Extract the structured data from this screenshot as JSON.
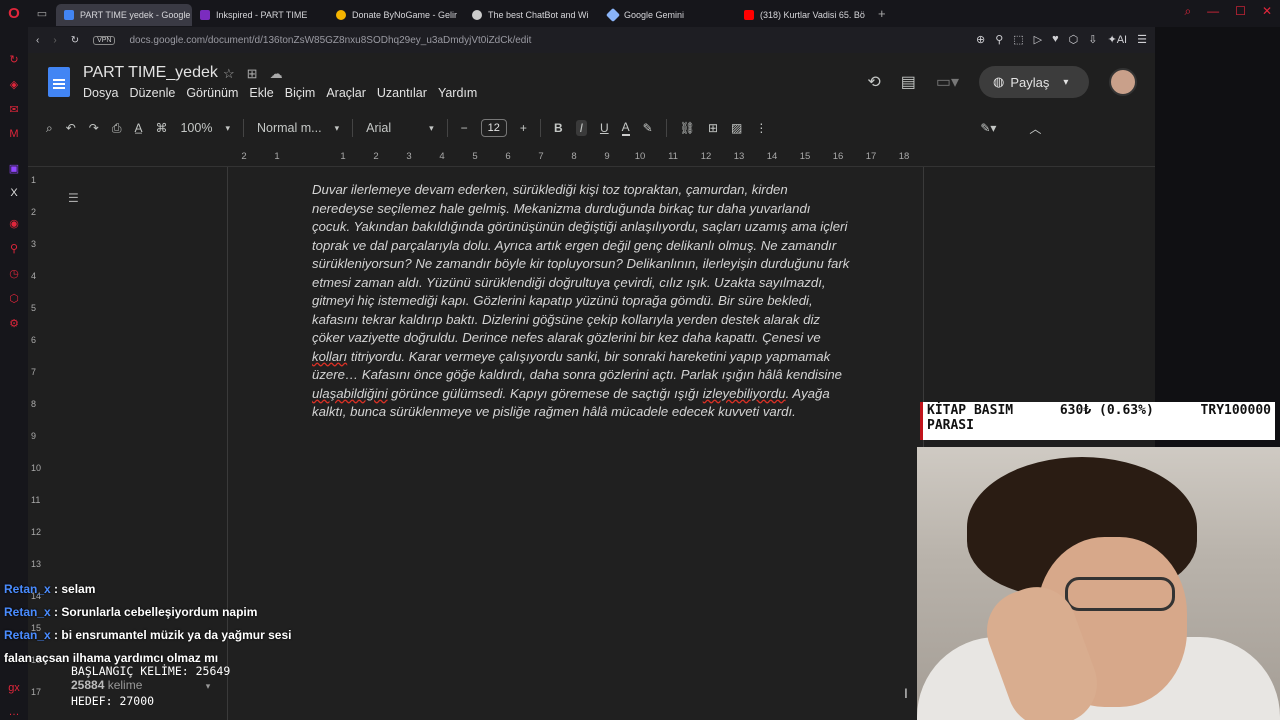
{
  "browser": {
    "tabs": [
      {
        "label": "PART TIME yedek - Google",
        "active": true,
        "color": "#4285f4"
      },
      {
        "label": "Inkspired - PART TIME",
        "active": false,
        "color": "#7b2cbf"
      },
      {
        "label": "Donate ByNoGame - Gelir",
        "active": false,
        "color": "#f4b400"
      },
      {
        "label": "The best ChatBot and Wi",
        "active": false,
        "color": "#cccccc"
      },
      {
        "label": "Google Gemini",
        "active": false,
        "color": "#8ab4f8"
      },
      {
        "label": "(318) Kurtlar Vadisi 65. Bö",
        "active": false,
        "color": "#ff0000"
      }
    ],
    "vpn": "VPN",
    "url": "docs.google.com/document/d/136tonZsW85GZ8nxu8SODhq29ey_u3aDmdyjVt0iZdCk/edit",
    "ai_label": "AI"
  },
  "docs": {
    "title": "PART TIME_yedek",
    "menu": [
      "Dosya",
      "Düzenle",
      "Görünüm",
      "Ekle",
      "Biçim",
      "Araçlar",
      "Uzantılar",
      "Yardım"
    ],
    "share_label": "Paylaş",
    "toolbar": {
      "zoom": "100%",
      "style": "Normal m...",
      "font": "Arial",
      "size": "12"
    },
    "ruler_h": [
      "2",
      "1",
      "",
      "1",
      "2",
      "3",
      "4",
      "5",
      "6",
      "7",
      "8",
      "9",
      "10",
      "11",
      "12",
      "13",
      "14",
      "15",
      "16",
      "17",
      "18"
    ],
    "ruler_v": [
      "1",
      "2",
      "3",
      "4",
      "5",
      "6",
      "7",
      "8",
      "9",
      "10",
      "11",
      "12",
      "13",
      "14",
      "15",
      "16",
      "17"
    ],
    "paragraph_parts": [
      "Duvar ilerlemeye devam ederken, sürüklediği kişi toz topraktan, çamurdan, kirden neredeyse seçilemez hale gelmiş. Mekanizma durduğunda birkaç tur daha yuvarlandı çocuk. Yakından bakıldığında görünüşünün değiştiği anlaşılıyordu, saçları uzamış ama içleri toprak ve dal parçalarıyla dolu. Ayrıca artık ergen değil genç delikanlı olmuş. Ne zamandır sürükleniyorsun? Ne zamandır böyle kir topluyorsun? Delikanlının, ilerleyişin durduğunu fark etmesi zaman aldı. Yüzünü sürüklendiği doğrultuya çevirdi, cılız ışık. Uzakta sayılmazdı, gitmeyi hiç istemediği kapı. Gözlerini kapatıp yüzünü toprağa gömdü. Bir süre bekledi, kafasını tekrar kaldırıp baktı. Dizlerini göğsüne çekip kollarıyla yerden destek alarak diz çöker vaziyette doğruldu. Derince nefes alarak gözlerini bir kez daha kapattı. Çenesi ve ",
      "kolları",
      " titriyordu. Karar vermeye çalışıyordu sanki, bir sonraki hareketini yapıp yapmamak üzere… Kafasını önce göğe kaldırdı, daha sonra gözlerini açtı. Parlak ışığın hâlâ kendisine ",
      "ulaşabildiğini",
      " görünce gülümsedi. Kapıyı göremese de saçtığı ışığı ",
      "izleyebiliyordu",
      ". Ayağa kalktı, bunca sürüklenmeye ve pisliğe rağmen hâlâ mücadele edecek kuvveti vardı."
    ],
    "word_count_value": "25884",
    "word_count_unit": "kelime"
  },
  "overlay": {
    "kitap": {
      "label1": "KİTAP BASIM",
      "label2": "PARASI",
      "amount": "630₺ (0.63%)",
      "target": "TRY100000"
    },
    "chat": [
      {
        "user": "Retan_x",
        "sep": " : ",
        "msg": "selam"
      },
      {
        "user": "Retan_x",
        "sep": " : ",
        "msg": "Sorunlarla cebelleşiyordum napim"
      },
      {
        "user": "Retan_x",
        "sep": " : ",
        "msg": "bi ensrumantel müzik ya da yağmur sesi falan açsan ilhama yardımcı olmaz mı"
      }
    ],
    "start_words": "BAŞLANGIÇ KELİME: 25649",
    "target_words": "HEDEF: 27000"
  }
}
